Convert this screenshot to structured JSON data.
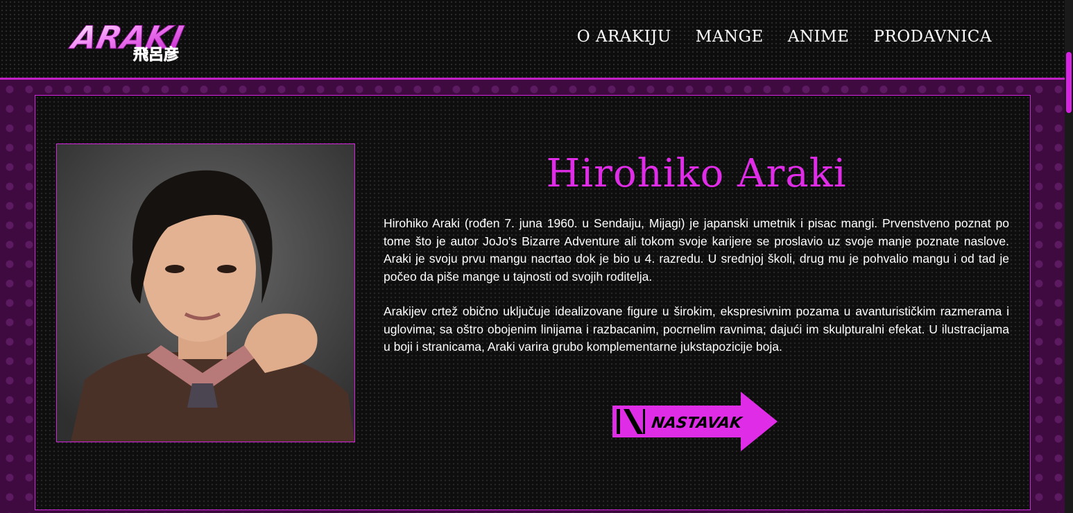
{
  "header": {
    "logo": {
      "text": "ARAKI",
      "kanji": "飛呂彦"
    },
    "nav": [
      {
        "label": "O ARAKIJU"
      },
      {
        "label": "MANGE"
      },
      {
        "label": "ANIME"
      },
      {
        "label": "PRODAVNICA"
      }
    ]
  },
  "main": {
    "title": "Hirohiko Araki",
    "paragraphs": [
      "Hirohiko Araki (rođen 7. juna 1960. u Sendaiju, Mijagi) je japanski umetnik i pisac mangi. Prvenstveno poznat po tome što je autor JoJo's Bizarre Adventure ali tokom svoje karijere se proslavio uz svoje manje poznate naslove. Araki je svoju prvu mangu nacrtao dok je bio u 4. razredu. U srednjoj školi, drug mu je pohvalio mangu i od tad je počeo da piše mange u tajnosti od svojih roditelja.",
      "Arakijev crtež obično uključuje idealizovane figure u širokim, ekspresivnim pozama u avanturističkim razmerama i uglovima; sa oštro obojenim linijama i razbacanim, pocrnelim ravnima; dajući im skulpturalni efekat. U ilustracijama u boji i stranicama, Araki varira grubo komplementarne jukstapozicije boja."
    ],
    "cta_label": "NASTAVAK"
  },
  "colors": {
    "accent": "#d424e0",
    "title": "#df2ce6",
    "band": "#3e0a40"
  }
}
